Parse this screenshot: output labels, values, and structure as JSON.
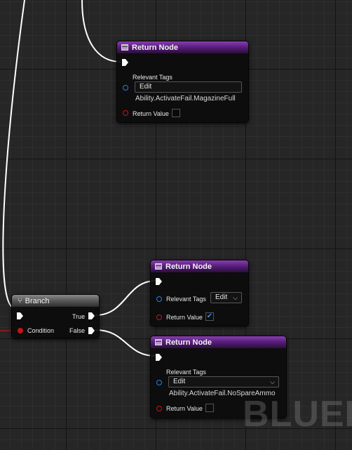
{
  "watermark": "BLUEP",
  "return_node_top": {
    "title": "Return Node",
    "tags_label": "Relevant Tags",
    "edit_label": "Edit",
    "tag_value": "Ability.ActivateFail.MagazineFull",
    "return_label": "Return Value",
    "checked": false
  },
  "branch": {
    "title": "Branch",
    "condition_label": "Condition",
    "true_label": "True",
    "false_label": "False"
  },
  "return_node_true": {
    "title": "Return Node",
    "tags_label": "Relevant Tags",
    "edit_label": "Edit",
    "return_label": "Return Value",
    "checked": true
  },
  "return_node_false": {
    "title": "Return Node",
    "tags_label": "Relevant Tags",
    "edit_label": "Edit",
    "tag_value": "Ability.ActivateFail.NoSpareAmmo",
    "return_label": "Return Value",
    "checked": false
  },
  "colors": {
    "exec_wire": "#ffffff",
    "bool_wire": "#a8161a",
    "gameplay_tag_pin": "#2b7de0",
    "node_header_function": "#5a1e80",
    "node_header_branch": "#5b5b5b"
  },
  "icons": {
    "function": "function-icon",
    "branch": "branch-icon",
    "dropdown": "chevron-down-icon",
    "check": "checkmark-icon"
  }
}
